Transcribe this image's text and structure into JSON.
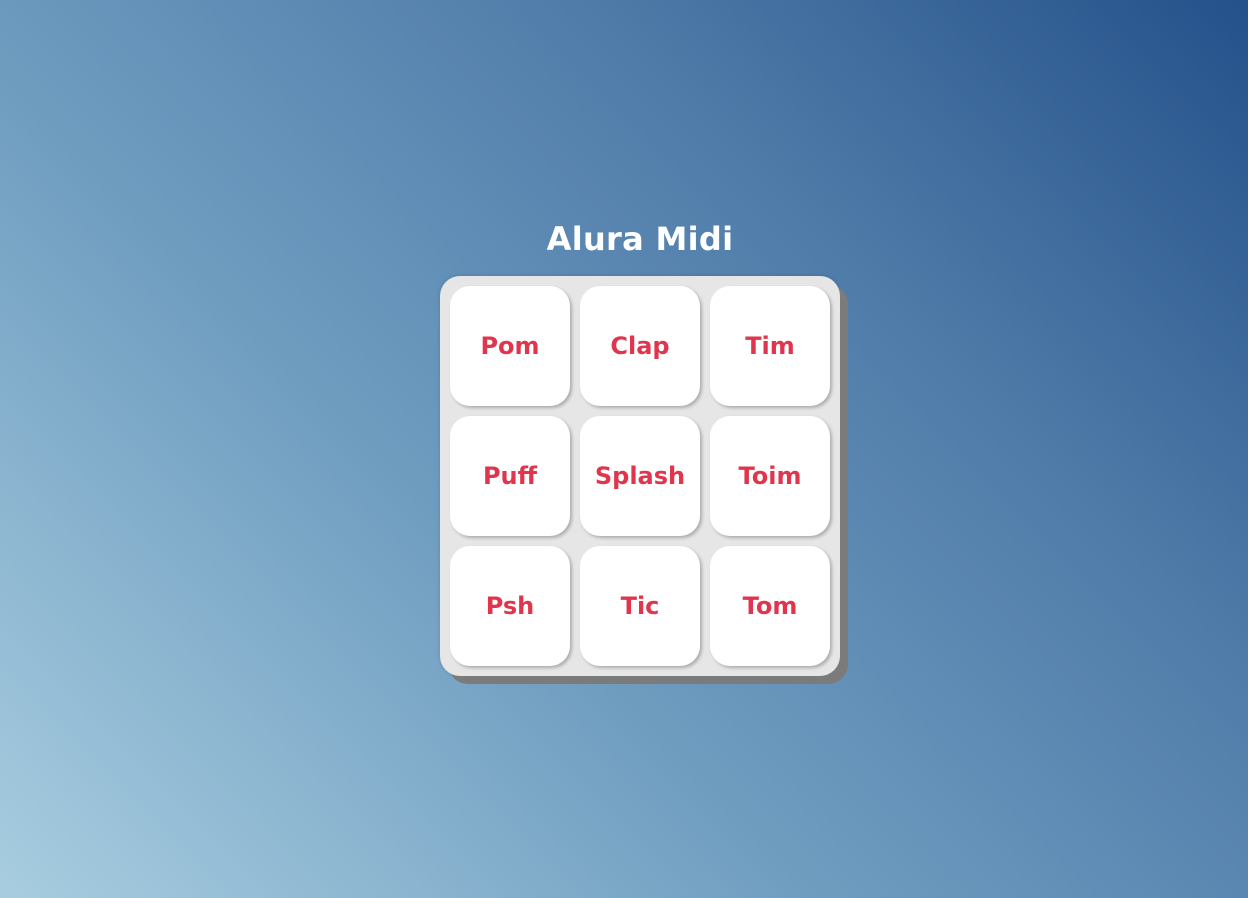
{
  "title": "Alura Midi",
  "keys": [
    {
      "label": "Pom"
    },
    {
      "label": "Clap"
    },
    {
      "label": "Tim"
    },
    {
      "label": "Puff"
    },
    {
      "label": "Splash"
    },
    {
      "label": "Toim"
    },
    {
      "label": "Psh"
    },
    {
      "label": "Tic"
    },
    {
      "label": "Tom"
    }
  ],
  "colors": {
    "key_text": "#e0364d",
    "key_background": "#ffffff",
    "keyboard_background": "#e6e6e6",
    "title_text": "#ffffff"
  }
}
